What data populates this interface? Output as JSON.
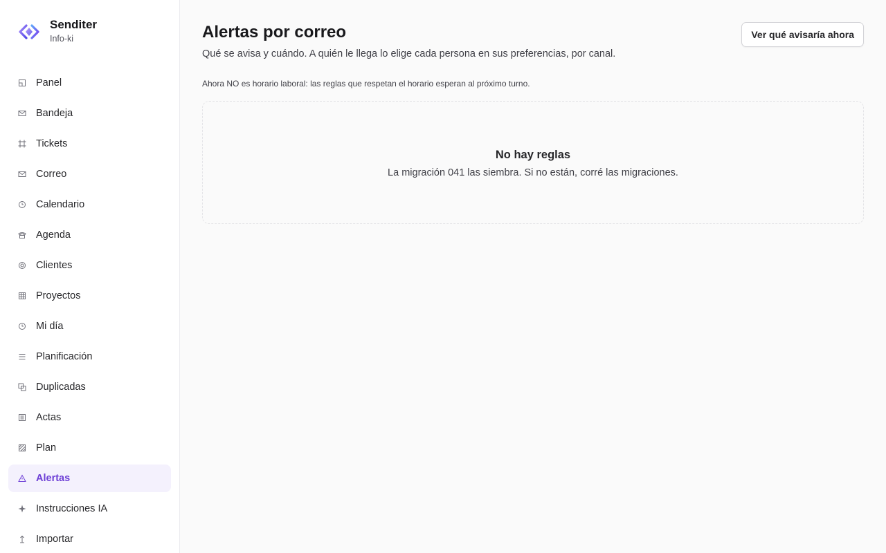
{
  "brand": {
    "name": "Senditer",
    "subtitle": "Info-ki",
    "logo_icon": "brand-logo-icon",
    "accent": "#6d3fd6"
  },
  "sidebar": {
    "items": [
      {
        "label": "Panel",
        "icon": "panel-icon",
        "active": false
      },
      {
        "label": "Bandeja",
        "icon": "envelope-icon",
        "active": false
      },
      {
        "label": "Tickets",
        "icon": "ticket-icon",
        "active": false
      },
      {
        "label": "Correo",
        "icon": "mail-icon",
        "active": false
      },
      {
        "label": "Calendario",
        "icon": "clock-icon",
        "active": false
      },
      {
        "label": "Agenda",
        "icon": "phone-icon",
        "active": false
      },
      {
        "label": "Clientes",
        "icon": "target-icon",
        "active": false
      },
      {
        "label": "Proyectos",
        "icon": "grid-icon",
        "active": false
      },
      {
        "label": "Mi día",
        "icon": "clock-icon",
        "active": false
      },
      {
        "label": "Planificación",
        "icon": "list-icon",
        "active": false
      },
      {
        "label": "Duplicadas",
        "icon": "copy-icon",
        "active": false
      },
      {
        "label": "Actas",
        "icon": "document-icon",
        "active": false
      },
      {
        "label": "Plan",
        "icon": "hatched-square-icon",
        "active": false
      },
      {
        "label": "Alertas",
        "icon": "warning-triangle-icon",
        "active": true
      },
      {
        "label": "Instrucciones IA",
        "icon": "sparkle-icon",
        "active": false
      },
      {
        "label": "Importar",
        "icon": "import-arrow-icon",
        "active": false
      }
    ]
  },
  "main": {
    "title": "Alertas por correo",
    "subtitle": "Qué se avisa y cuándo. A quién le llega lo elige cada persona en sus preferencias, por canal.",
    "preview_button": "Ver qué avisaría ahora",
    "notice": "Ahora NO es horario laboral: las reglas que respetan el horario esperan al próximo turno.",
    "empty_state": {
      "title": "No hay reglas",
      "text": "La migración 041 las siembra. Si no están, corré las migraciones."
    }
  }
}
